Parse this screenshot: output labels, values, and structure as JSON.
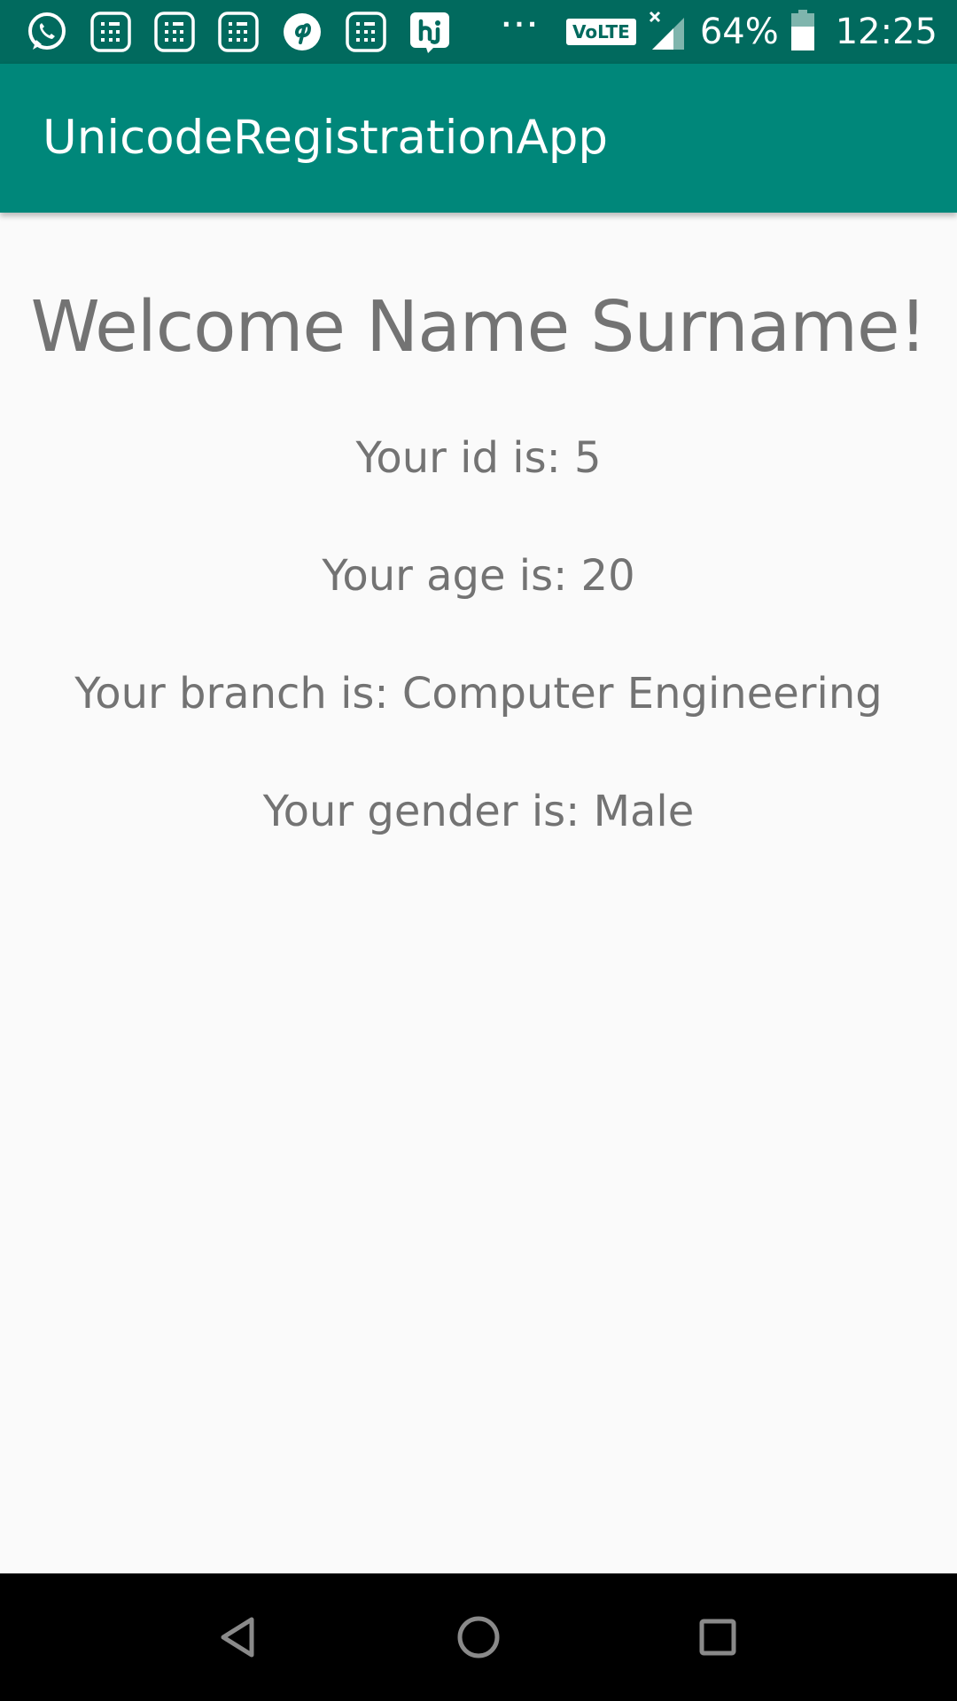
{
  "status_bar": {
    "left_icons": [
      "whatsapp-icon",
      "notification-app-icon",
      "notification-app-icon",
      "notification-app-icon",
      "pinterest-icon",
      "notification-app-icon",
      "hike-icon"
    ],
    "more_dots": "···",
    "network_label": "VoLTE",
    "battery_percent": "64%",
    "time": "12:25",
    "colors": {
      "background": "#016a5e",
      "foreground": "#ffffff"
    }
  },
  "app_bar": {
    "title": "UnicodeRegistrationApp",
    "color": "#00877a"
  },
  "main": {
    "welcome": "Welcome Name Surname!",
    "details": {
      "id": "Your id is: 5",
      "age": "Your age is: 20",
      "branch": "Your branch is: Computer Engineering",
      "gender": "Your gender is: Male"
    },
    "text_color": "#737373",
    "background": "#fafafa"
  },
  "nav_bar": {
    "buttons": [
      "back-icon",
      "home-icon",
      "recents-icon"
    ],
    "background": "#000000"
  }
}
